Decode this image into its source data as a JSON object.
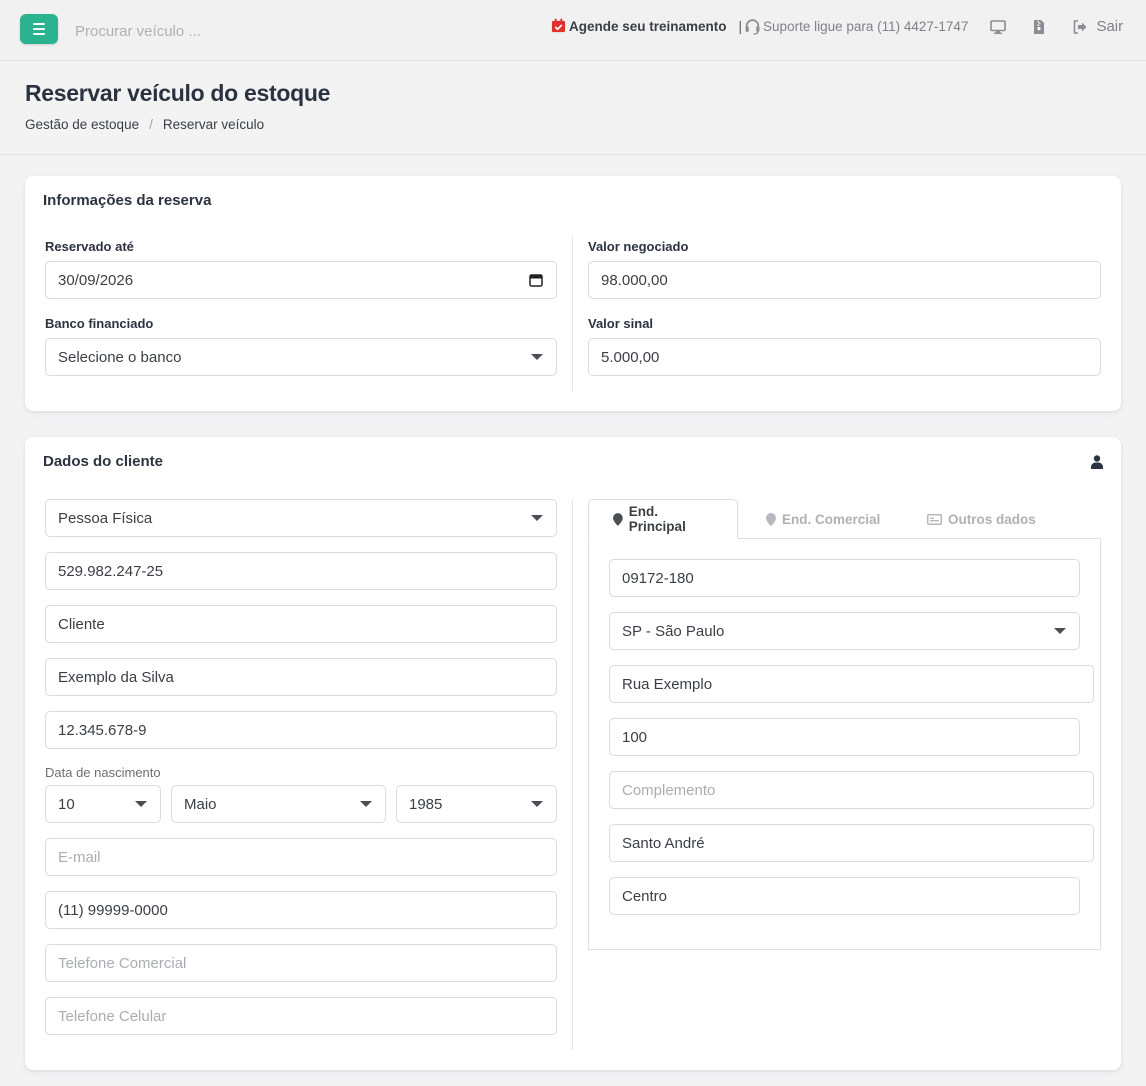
{
  "topbar": {
    "search_placeholder": "Procurar veículo ...",
    "training_label": "Agende seu treinamento",
    "separator": "|",
    "support_label": "Suporte ligue para (11) 4427-1747",
    "exit_label": "Sair",
    "accent_color": "#2bb38f",
    "training_icon_color": "#e0302c"
  },
  "header": {
    "title": "Reservar veículo do estoque",
    "breadcrumb": [
      "Gestão de estoque",
      "/",
      "Reservar veículo"
    ]
  },
  "reservation": {
    "title": "Informações da reserva",
    "reserved_until_label": "Reservado até",
    "reserved_until_value": "30/09/2026",
    "bank_label": "Banco financiado",
    "bank_value": "Selecione o banco",
    "negotiated_label": "Valor negociado",
    "negotiated_value": "98.000,00",
    "signal_label": "Valor sinal",
    "signal_value": "5.000,00"
  },
  "client": {
    "title": "Dados do cliente",
    "person_type": "Pessoa Física",
    "cpf": "529.982.247-25",
    "first_name": "Cliente",
    "last_name": "Exemplo da Silva",
    "rg": "12.345.678-9",
    "birth_label": "Data de nascimento",
    "birth_day": "10",
    "birth_month": "Maio",
    "birth_year": "1985",
    "email_placeholder": "E-mail",
    "phone": "(11) 99999-0000",
    "work_phone_placeholder": "Telefone Comercial",
    "cell_phone_placeholder": "Telefone Celular"
  },
  "address": {
    "tabs": [
      "End. Principal",
      "End. Comercial",
      "Outros dados"
    ],
    "active_tab": "End. Principal",
    "cep": "09172-180",
    "state": "SP - São Paulo",
    "street": "Rua Exemplo",
    "number": "100",
    "complement_placeholder": "Complemento",
    "city": "Santo André",
    "district": "Centro"
  }
}
